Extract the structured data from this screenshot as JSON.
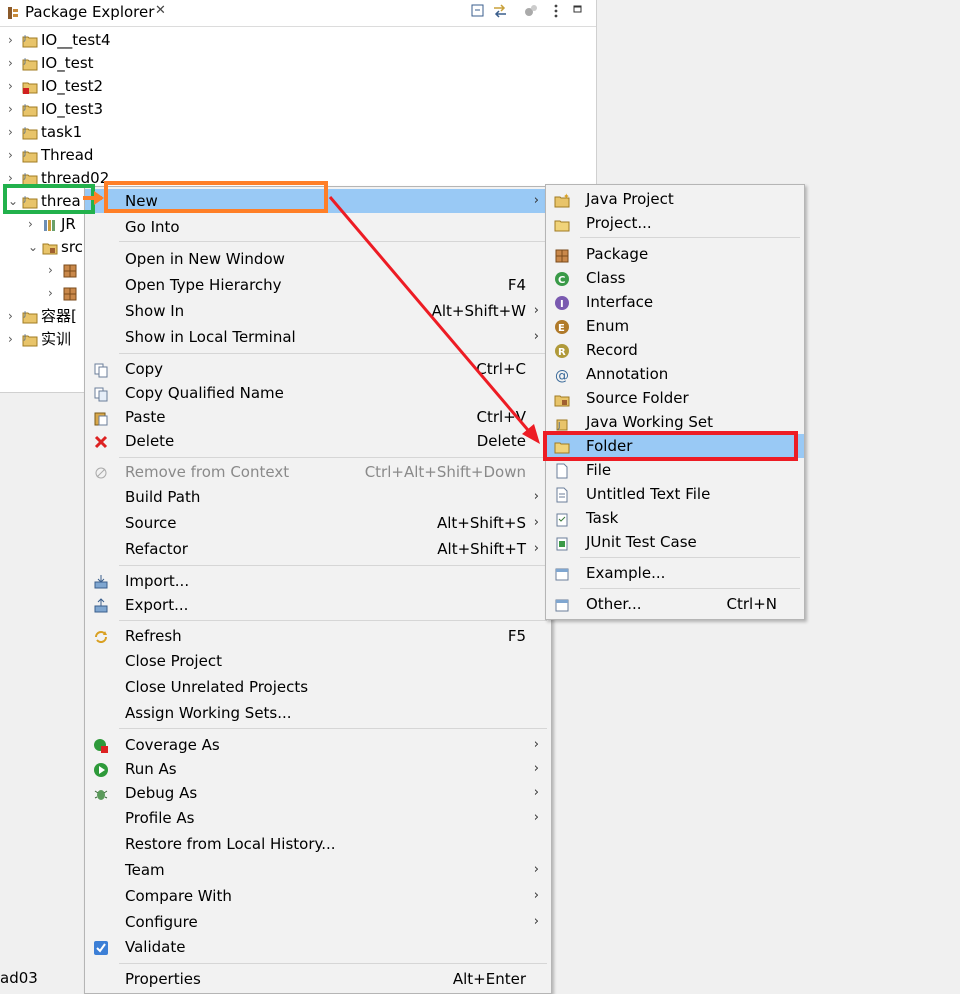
{
  "explorer": {
    "title": "Package Explorer",
    "close_glyph": "✕",
    "tree": [
      {
        "label": "IO__test4",
        "icon": "java-project-icon",
        "twisty": "›"
      },
      {
        "label": "IO_test",
        "icon": "java-project-icon",
        "twisty": "›"
      },
      {
        "label": "IO_test2",
        "icon": "java-project-error-icon",
        "twisty": "›"
      },
      {
        "label": "IO_test3",
        "icon": "java-project-icon",
        "twisty": "›"
      },
      {
        "label": "task1",
        "icon": "java-project-icon",
        "twisty": "›"
      },
      {
        "label": "Thread",
        "icon": "java-project-icon",
        "twisty": "›"
      },
      {
        "label": "thread02",
        "icon": "java-project-icon",
        "twisty": "›"
      },
      {
        "label": "threa",
        "icon": "java-project-icon",
        "twisty": "⌄"
      },
      {
        "label": "JR",
        "icon": "library-icon",
        "twisty": "›"
      },
      {
        "label": "src",
        "icon": "source-folder-icon",
        "twisty": "⌄"
      },
      {
        "label": "",
        "icon": "package-icon",
        "twisty": "›"
      },
      {
        "label": "",
        "icon": "package-icon",
        "twisty": "›"
      },
      {
        "label": "容器[",
        "icon": "java-project-icon",
        "twisty": "›"
      },
      {
        "label": "实训",
        "icon": "java-project-icon",
        "twisty": "›"
      }
    ]
  },
  "context_menu": {
    "items": [
      {
        "label": "New",
        "shortcut": "",
        "submenu": true,
        "icon": "",
        "highlight": true
      },
      {
        "label": "Go Into",
        "shortcut": "",
        "submenu": false,
        "icon": ""
      },
      {
        "label": "Open in New Window",
        "shortcut": "",
        "submenu": false,
        "icon": ""
      },
      {
        "label": "Open Type Hierarchy",
        "shortcut": "F4",
        "submenu": false,
        "icon": ""
      },
      {
        "label": "Show In",
        "shortcut": "Alt+Shift+W",
        "submenu": true,
        "icon": ""
      },
      {
        "label": "Show in Local Terminal",
        "shortcut": "",
        "submenu": true,
        "icon": ""
      },
      {
        "label": "Copy",
        "shortcut": "Ctrl+C",
        "submenu": false,
        "icon": "copy-icon"
      },
      {
        "label": "Copy Qualified Name",
        "shortcut": "",
        "submenu": false,
        "icon": "copy-qualified-icon"
      },
      {
        "label": "Paste",
        "shortcut": "Ctrl+V",
        "submenu": false,
        "icon": "paste-icon"
      },
      {
        "label": "Delete",
        "shortcut": "Delete",
        "submenu": false,
        "icon": "delete-icon"
      },
      {
        "label": "Remove from Context",
        "shortcut": "Ctrl+Alt+Shift+Down",
        "submenu": false,
        "icon": "remove-context-icon",
        "disabled": true
      },
      {
        "label": "Build Path",
        "shortcut": "",
        "submenu": true,
        "icon": ""
      },
      {
        "label": "Source",
        "shortcut": "Alt+Shift+S",
        "submenu": true,
        "icon": ""
      },
      {
        "label": "Refactor",
        "shortcut": "Alt+Shift+T",
        "submenu": true,
        "icon": ""
      },
      {
        "label": "Import...",
        "shortcut": "",
        "submenu": false,
        "icon": "import-icon"
      },
      {
        "label": "Export...",
        "shortcut": "",
        "submenu": false,
        "icon": "export-icon"
      },
      {
        "label": "Refresh",
        "shortcut": "F5",
        "submenu": false,
        "icon": "refresh-icon"
      },
      {
        "label": "Close Project",
        "shortcut": "",
        "submenu": false,
        "icon": ""
      },
      {
        "label": "Close Unrelated Projects",
        "shortcut": "",
        "submenu": false,
        "icon": ""
      },
      {
        "label": "Assign Working Sets...",
        "shortcut": "",
        "submenu": false,
        "icon": ""
      },
      {
        "label": "Coverage As",
        "shortcut": "",
        "submenu": true,
        "icon": "coverage-icon"
      },
      {
        "label": "Run As",
        "shortcut": "",
        "submenu": true,
        "icon": "run-icon"
      },
      {
        "label": "Debug As",
        "shortcut": "",
        "submenu": true,
        "icon": "debug-icon"
      },
      {
        "label": "Profile As",
        "shortcut": "",
        "submenu": true,
        "icon": ""
      },
      {
        "label": "Restore from Local History...",
        "shortcut": "",
        "submenu": false,
        "icon": ""
      },
      {
        "label": "Team",
        "shortcut": "",
        "submenu": true,
        "icon": ""
      },
      {
        "label": "Compare With",
        "shortcut": "",
        "submenu": true,
        "icon": ""
      },
      {
        "label": "Configure",
        "shortcut": "",
        "submenu": true,
        "icon": ""
      },
      {
        "label": "Validate",
        "shortcut": "",
        "submenu": false,
        "icon": "validate-check-icon"
      },
      {
        "label": "Properties",
        "shortcut": "Alt+Enter",
        "submenu": false,
        "icon": ""
      }
    ]
  },
  "new_submenu": {
    "items": [
      {
        "label": "Java Project",
        "shortcut": "",
        "icon": "java-project-new-icon"
      },
      {
        "label": "Project...",
        "shortcut": "",
        "icon": "project-new-icon"
      },
      {
        "label": "Package",
        "shortcut": "",
        "icon": "package-new-icon"
      },
      {
        "label": "Class",
        "shortcut": "",
        "icon": "class-icon"
      },
      {
        "label": "Interface",
        "shortcut": "",
        "icon": "interface-icon"
      },
      {
        "label": "Enum",
        "shortcut": "",
        "icon": "enum-icon"
      },
      {
        "label": "Record",
        "shortcut": "",
        "icon": "record-icon"
      },
      {
        "label": "Annotation",
        "shortcut": "",
        "icon": "annotation-icon"
      },
      {
        "label": "Source Folder",
        "shortcut": "",
        "icon": "source-folder-new-icon"
      },
      {
        "label": "Java Working Set",
        "shortcut": "",
        "icon": "working-set-icon"
      },
      {
        "label": "Folder",
        "shortcut": "",
        "icon": "folder-icon",
        "highlight": true
      },
      {
        "label": "File",
        "shortcut": "",
        "icon": "file-icon"
      },
      {
        "label": "Untitled Text File",
        "shortcut": "",
        "icon": "text-file-icon"
      },
      {
        "label": "Task",
        "shortcut": "",
        "icon": "task-icon"
      },
      {
        "label": "JUnit Test Case",
        "shortcut": "",
        "icon": "junit-icon"
      },
      {
        "label": "Example...",
        "shortcut": "",
        "icon": "example-icon"
      },
      {
        "label": "Other...",
        "shortcut": "Ctrl+N",
        "icon": "other-wizard-icon"
      }
    ]
  },
  "statusbar": {
    "text": "ad03"
  },
  "annotation_colors": {
    "green": "#22b14c",
    "orange": "#ff7f27",
    "red": "#ed1c24"
  }
}
